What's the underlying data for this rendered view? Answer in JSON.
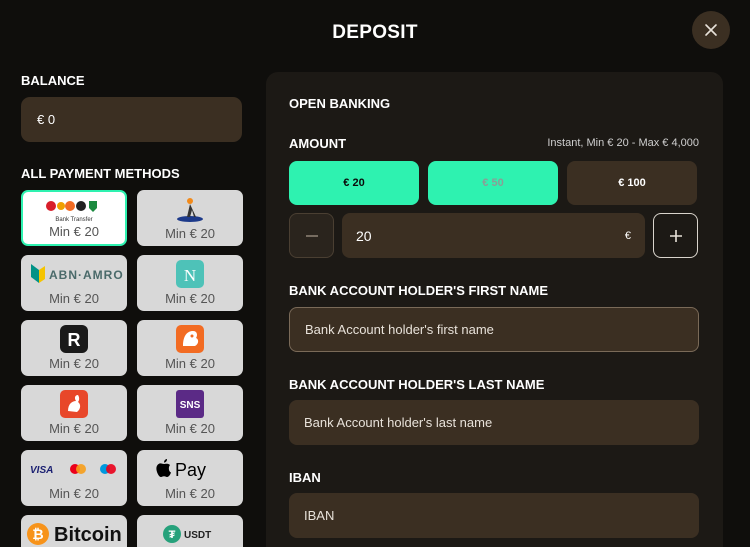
{
  "modal": {
    "title": "DEPOSIT",
    "close_icon": "close-icon"
  },
  "balance": {
    "label": "BALANCE",
    "value": "€ 0"
  },
  "methods": {
    "label": "ALL PAYMENT METHODS",
    "items": [
      {
        "name": "Bank Transfer",
        "min": "Min € 20",
        "selected": true,
        "logo_text": "Bank Transfer"
      },
      {
        "name": "Bancontact figure",
        "min": "Min € 20",
        "selected": false,
        "logo_text": ""
      },
      {
        "name": "ABN AMRO",
        "min": "Min € 20",
        "selected": false,
        "logo_text": "ABN·AMRO"
      },
      {
        "name": "N bank",
        "min": "Min € 20",
        "selected": false,
        "logo_text": "N"
      },
      {
        "name": "Revolut",
        "min": "Min € 20",
        "selected": false,
        "logo_text": "R"
      },
      {
        "name": "ING",
        "min": "Min € 20",
        "selected": false,
        "logo_text": ""
      },
      {
        "name": "Rabobank",
        "min": "Min € 20",
        "selected": false,
        "logo_text": ""
      },
      {
        "name": "SNS",
        "min": "Min € 20",
        "selected": false,
        "logo_text": "SNS"
      },
      {
        "name": "Cards",
        "min": "Min € 20",
        "selected": false,
        "logo_text": "VISA"
      },
      {
        "name": "Apple Pay",
        "min": "Min € 20",
        "selected": false,
        "logo_text": "Pay"
      },
      {
        "name": "Bitcoin",
        "min": "",
        "selected": false,
        "logo_text": "Bitcoin"
      },
      {
        "name": "USDT",
        "min": "",
        "selected": false,
        "logo_text": "USDT"
      }
    ]
  },
  "panel": {
    "heading": "OPEN BANKING",
    "amount_label": "AMOUNT",
    "amount_note": "Instant, Min € 20 - Max € 4,000",
    "chips": [
      "€ 20",
      "€ 50",
      "€ 100"
    ],
    "amount_value": "20",
    "currency_symbol": "€",
    "first_name_label": "BANK ACCOUNT HOLDER'S FIRST NAME",
    "first_name_placeholder": "Bank Account holder's first name",
    "last_name_label": "BANK ACCOUNT HOLDER'S LAST NAME",
    "last_name_placeholder": "Bank Account holder's last name",
    "iban_label": "IBAN",
    "iban_placeholder": "IBAN"
  },
  "colors": {
    "accent": "#2ef2b0",
    "field": "#3b2f22",
    "panel": "#1c1915",
    "background": "#0f0e0c"
  }
}
